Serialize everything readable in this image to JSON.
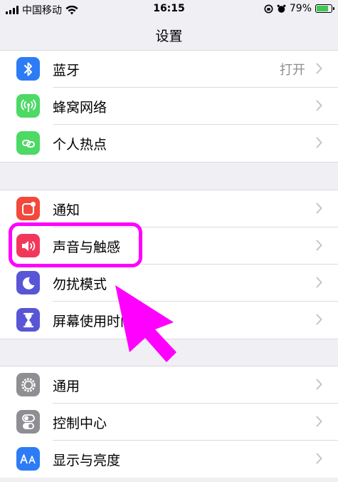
{
  "status_bar": {
    "carrier": "中国移动",
    "time": "16:15",
    "battery_percent": "79%",
    "battery_level": 0.79,
    "battery_color": "#3fc653"
  },
  "header": {
    "title": "设置"
  },
  "groups": [
    {
      "items": [
        {
          "label": "蓝牙",
          "value": "打开",
          "icon": "bluetooth-icon",
          "icon_color": "#2d7cf6"
        },
        {
          "label": "蜂窝网络",
          "icon": "cellular-icon",
          "icon_color": "#4cd964"
        },
        {
          "label": "个人热点",
          "icon": "hotspot-icon",
          "icon_color": "#4cd964"
        }
      ]
    },
    {
      "items": [
        {
          "label": "通知",
          "icon": "notifications-icon",
          "icon_color": "#f2493c"
        },
        {
          "label": "声音与触感",
          "icon": "speaker-icon",
          "icon_color": "#f2385a"
        },
        {
          "label": "勿扰模式",
          "icon": "moon-icon",
          "icon_color": "#5856d6"
        },
        {
          "label": "屏幕使用时间",
          "icon": "hourglass-icon",
          "icon_color": "#5856d6"
        }
      ]
    },
    {
      "items": [
        {
          "label": "通用",
          "icon": "gear-icon",
          "icon_color": "#8e8e93"
        },
        {
          "label": "控制中心",
          "icon": "toggles-icon",
          "icon_color": "#8e8e93"
        },
        {
          "label": "显示与亮度",
          "icon": "display-icon",
          "icon_color": "#2d7cf6"
        }
      ]
    }
  ],
  "annotation": {
    "color": "#ff00ff"
  }
}
